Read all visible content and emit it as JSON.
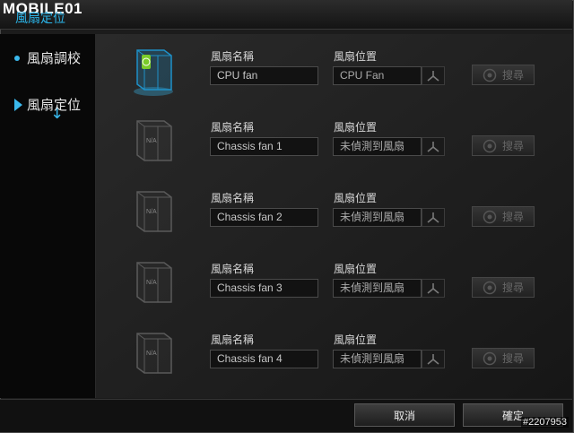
{
  "brand": {
    "logo_text": "MOBILE01"
  },
  "window": {
    "title": "風扇定位"
  },
  "sidebar": {
    "items": [
      {
        "label": "風扇調校",
        "active": false
      },
      {
        "label": "風扇定位",
        "active": true
      }
    ]
  },
  "fans": [
    {
      "name_label": "風扇名稱",
      "name": "CPU fan",
      "position_label": "風扇位置",
      "position": "CPU Fan",
      "search_label": "搜尋",
      "detected": true,
      "image_text": ""
    },
    {
      "name_label": "風扇名稱",
      "name": "Chassis fan 1",
      "position_label": "風扇位置",
      "position": "未偵測到風扇",
      "search_label": "搜尋",
      "detected": false,
      "image_text": "N/A"
    },
    {
      "name_label": "風扇名稱",
      "name": "Chassis fan 2",
      "position_label": "風扇位置",
      "position": "未偵測到風扇",
      "search_label": "搜尋",
      "detected": false,
      "image_text": "N/A"
    },
    {
      "name_label": "風扇名稱",
      "name": "Chassis fan 3",
      "position_label": "風扇位置",
      "position": "未偵測到風扇",
      "search_label": "搜尋",
      "detected": false,
      "image_text": "N/A"
    },
    {
      "name_label": "風扇名稱",
      "name": "Chassis fan 4",
      "position_label": "風扇位置",
      "position": "未偵測到風扇",
      "search_label": "搜尋",
      "detected": false,
      "image_text": "N/A"
    }
  ],
  "footer": {
    "cancel_label": "取消",
    "ok_label": "確定"
  },
  "watermark": "#2207953",
  "colors": {
    "accent": "#3ab8ec",
    "fan_active": "#1e90c8",
    "fan_indicator": "#7acb2a"
  },
  "icons": {
    "position_icon": "fan-position-icon",
    "search_icon": "radar-icon"
  }
}
